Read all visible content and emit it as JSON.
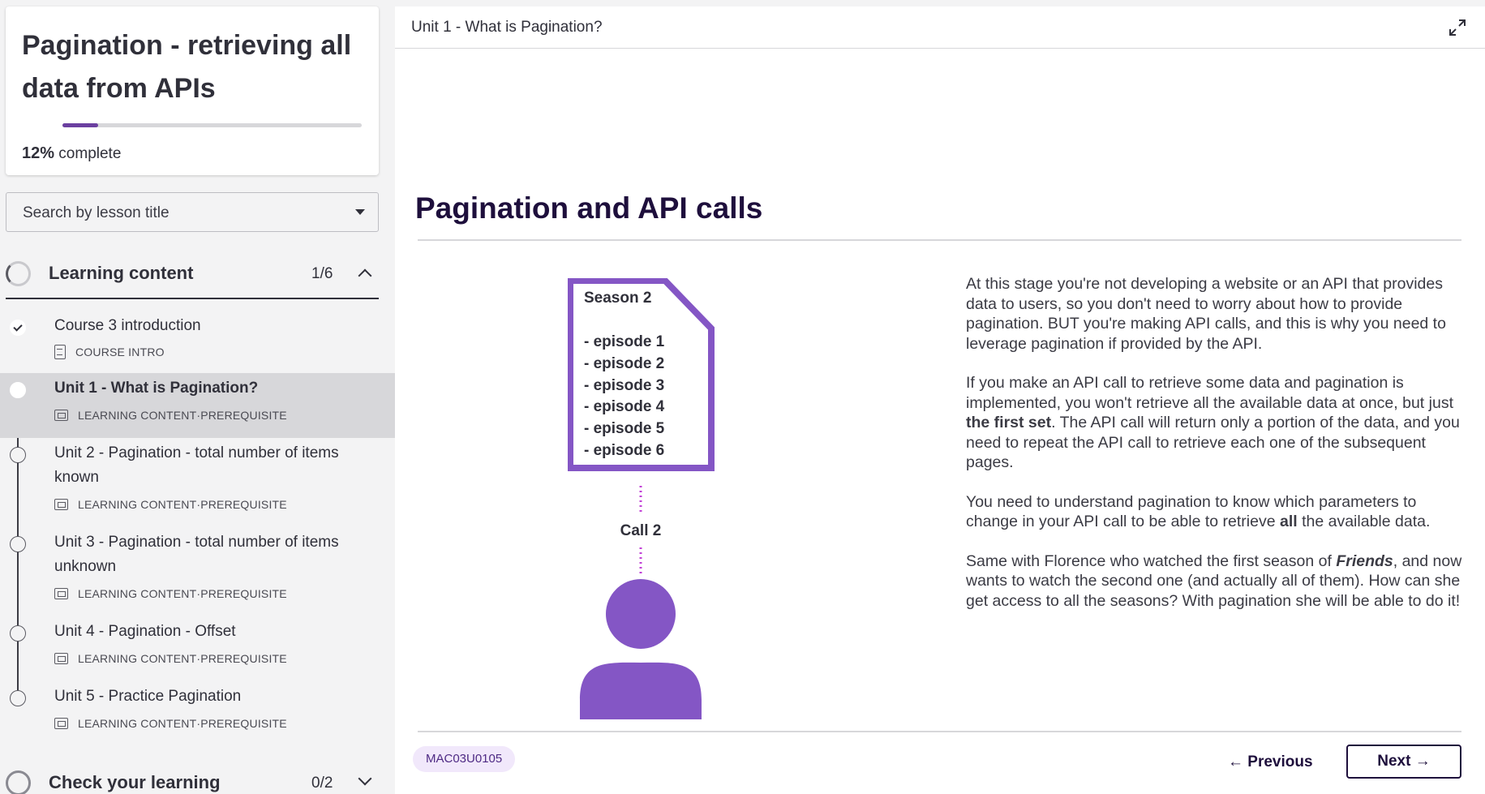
{
  "course": {
    "title": "Pagination - retrieving all data from APIs",
    "progress_percent": 12,
    "progress_value": "12%",
    "progress_suffix": " complete"
  },
  "search": {
    "label": "Search by lesson title"
  },
  "sections": [
    {
      "title": "Learning content",
      "count": "1/6",
      "expanded": true
    },
    {
      "title": "Check your learning",
      "count": "0/2",
      "expanded": false
    }
  ],
  "lessons": [
    {
      "title": "Course 3 introduction",
      "type": "COURSE INTRO",
      "tag": "",
      "status": "done",
      "icon": "document-icon"
    },
    {
      "title": "Unit 1 - What is Pagination?",
      "type": "LEARNING CONTENT",
      "tag": "PREREQUISITE",
      "status": "current",
      "icon": "screen-icon"
    },
    {
      "title": "Unit 2 - Pagination - total number of items known",
      "type": "LEARNING CONTENT",
      "tag": "PREREQUISITE",
      "status": "todo",
      "icon": "screen-icon"
    },
    {
      "title": "Unit 3 - Pagination - total number of items unknown",
      "type": "LEARNING CONTENT",
      "tag": "PREREQUISITE",
      "status": "todo",
      "icon": "screen-icon"
    },
    {
      "title": "Unit 4 - Pagination - Offset",
      "type": "LEARNING CONTENT",
      "tag": "PREREQUISITE",
      "status": "todo",
      "icon": "screen-icon"
    },
    {
      "title": "Unit 5 - Practice Pagination",
      "type": "LEARNING CONTENT",
      "tag": "PREREQUISITE",
      "status": "todo",
      "icon": "screen-icon"
    }
  ],
  "meta_separator": " · ",
  "main": {
    "topbar_title": "Unit 1 - What is Pagination?",
    "content_title": "Pagination and API calls",
    "illustration": {
      "doc_heading": "Season 2",
      "episodes": [
        "- episode 1",
        "- episode 2",
        "- episode 3",
        "- episode 4",
        "- episode 5",
        "- episode 6"
      ],
      "call_label": "Call 2",
      "accent_color": "#8456c5"
    },
    "paragraphs": [
      {
        "text": "At this stage you're not developing a website or an API that provides data to users, so you don't need to worry about how to provide pagination. BUT you're making API calls, and this is why you need to leverage pagination if provided by the API."
      },
      {
        "before": "If you make an API call to retrieve some data and pagination is implemented, you won't retrieve all the available data at once, but just ",
        "bold": "the first set",
        "after": ". The API call will return only a portion of the data, and you need to repeat the API call to retrieve each one of the subsequent pages."
      },
      {
        "before": "You need to understand pagination to know which parameters to change in your API call to be able to retrieve ",
        "bold": "all",
        "after": " the available data."
      },
      {
        "before": "Same with Florence who watched the first season of ",
        "bold_italic": "Friends",
        "after": ", and now wants to watch the second one (and actually all of them). How can she get access to all the seasons? With pagination she will be able to do it!"
      }
    ],
    "lesson_code": "MAC03U0105",
    "prev_label": "← Previous",
    "next_label": "Next →"
  },
  "colors": {
    "brand": "#1e0f3c",
    "accent": "#8456c5",
    "badge_bg": "#f1e8fb",
    "progress": "#6b3fa0"
  }
}
